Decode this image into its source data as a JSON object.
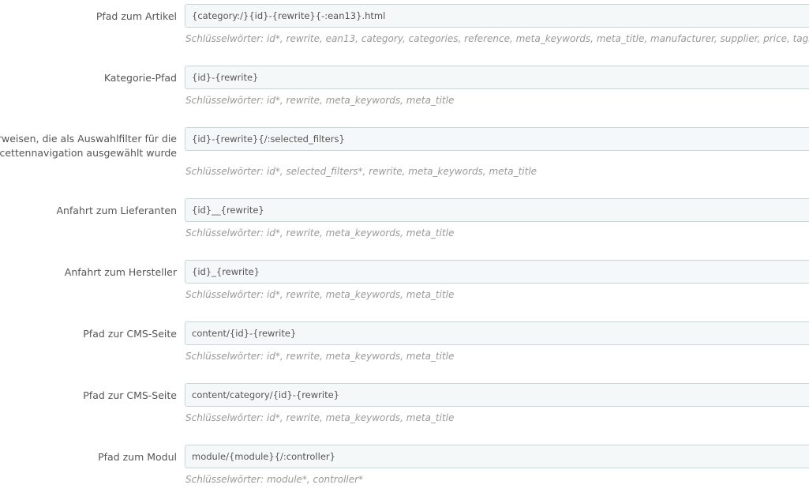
{
  "fields": [
    {
      "label_lines": [
        "Pfad zum Artikel"
      ],
      "value": "{category:/}{id}-{rewrite}{-:ean13}.html",
      "help": "Schlüsselwörter: id*, rewrite, ean13, category, categories, reference, meta_keywords, meta_title, manufacturer, supplier, price, tags"
    },
    {
      "label_lines": [
        "Kategorie-Pfad"
      ],
      "value": "{id}-{rewrite}",
      "help": "Schlüsselwörter: id*, rewrite, meta_keywords, meta_title"
    },
    {
      "label_lines": [
        "erweisen, die als Auswahlfilter für die",
        "Facettennavigation ausgewählt wurde"
      ],
      "value": "{id}-{rewrite}{/:selected_filters}",
      "help": "Schlüsselwörter: id*, selected_filters*, rewrite, meta_keywords, meta_title"
    },
    {
      "label_lines": [
        "Anfahrt zum Lieferanten"
      ],
      "value": "{id}__{rewrite}",
      "help": "Schlüsselwörter: id*, rewrite, meta_keywords, meta_title"
    },
    {
      "label_lines": [
        "Anfahrt zum Hersteller"
      ],
      "value": "{id}_{rewrite}",
      "help": "Schlüsselwörter: id*, rewrite, meta_keywords, meta_title"
    },
    {
      "label_lines": [
        "Pfad zur CMS-Seite"
      ],
      "value": "content/{id}-{rewrite}",
      "help": "Schlüsselwörter: id*, rewrite, meta_keywords, meta_title"
    },
    {
      "label_lines": [
        "Pfad zur CMS-Seite"
      ],
      "value": "content/category/{id}-{rewrite}",
      "help": "Schlüsselwörter: id*, rewrite, meta_keywords, meta_title"
    },
    {
      "label_lines": [
        "Pfad zum Modul"
      ],
      "value": "module/{module}{/:controller}",
      "help": "Schlüsselwörter: module*, controller*"
    }
  ]
}
